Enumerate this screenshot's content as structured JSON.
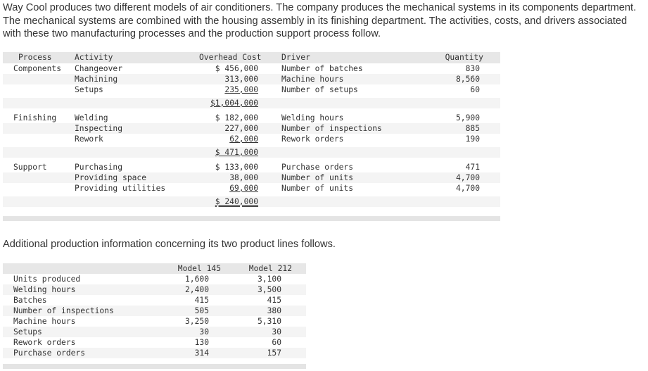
{
  "intro": "Way Cool produces two different models of air conditioners. The company produces the mechanical systems in its components department. The mechanical systems are combined with the housing assembly in its finishing department. The activities, costs, and drivers associated with these two manufacturing processes and the production support process follow.",
  "activities_table": {
    "headers": {
      "process": "Process",
      "activity": "Activity",
      "overhead_cost": "Overhead Cost",
      "driver": "Driver",
      "quantity": "Quantity"
    },
    "groups": [
      {
        "process": "Components",
        "rows": [
          {
            "activity": "Changeover",
            "cost": "$ 456,000",
            "driver": "Number of batches",
            "quantity": "830"
          },
          {
            "activity": "Machining",
            "cost": "313,000",
            "driver": "Machine hours",
            "quantity": "8,560"
          },
          {
            "activity": "Setups",
            "cost": "235,000",
            "driver": "Number of setups",
            "quantity": "60"
          }
        ],
        "total": "$1,004,000"
      },
      {
        "process": "Finishing",
        "rows": [
          {
            "activity": "Welding",
            "cost": "$ 182,000",
            "driver": "Welding hours",
            "quantity": "5,900"
          },
          {
            "activity": "Inspecting",
            "cost": "227,000",
            "driver": "Number of inspections",
            "quantity": "885"
          },
          {
            "activity": "Rework",
            "cost": "62,000",
            "driver": "Rework orders",
            "quantity": "190"
          }
        ],
        "total": "$ 471,000"
      },
      {
        "process": "Support",
        "rows": [
          {
            "activity": "Purchasing",
            "cost": "$ 133,000",
            "driver": "Purchase orders",
            "quantity": "471"
          },
          {
            "activity": "Providing space",
            "cost": "38,000",
            "driver": "Number of units",
            "quantity": "4,700"
          },
          {
            "activity": "Providing utilities",
            "cost": "69,000",
            "driver": "Number of units",
            "quantity": "4,700"
          }
        ],
        "total": "$ 240,000"
      }
    ]
  },
  "additional_text": "Additional production information concerning its two product lines follows.",
  "production_table": {
    "headers": {
      "model_145": "Model 145",
      "model_212": "Model 212"
    },
    "rows": [
      {
        "label": "Units produced",
        "model_145": "1,600",
        "model_212": "3,100"
      },
      {
        "label": "Welding hours",
        "model_145": "2,400",
        "model_212": "3,500"
      },
      {
        "label": "Batches",
        "model_145": "415",
        "model_212": "415"
      },
      {
        "label": "Number of inspections",
        "model_145": "505",
        "model_212": "380"
      },
      {
        "label": "Machine hours",
        "model_145": "3,250",
        "model_212": "5,310"
      },
      {
        "label": "Setups",
        "model_145": "30",
        "model_212": "30"
      },
      {
        "label": "Rework orders",
        "model_145": "130",
        "model_212": "60"
      },
      {
        "label": "Purchase orders",
        "model_145": "314",
        "model_212": "157"
      }
    ]
  }
}
